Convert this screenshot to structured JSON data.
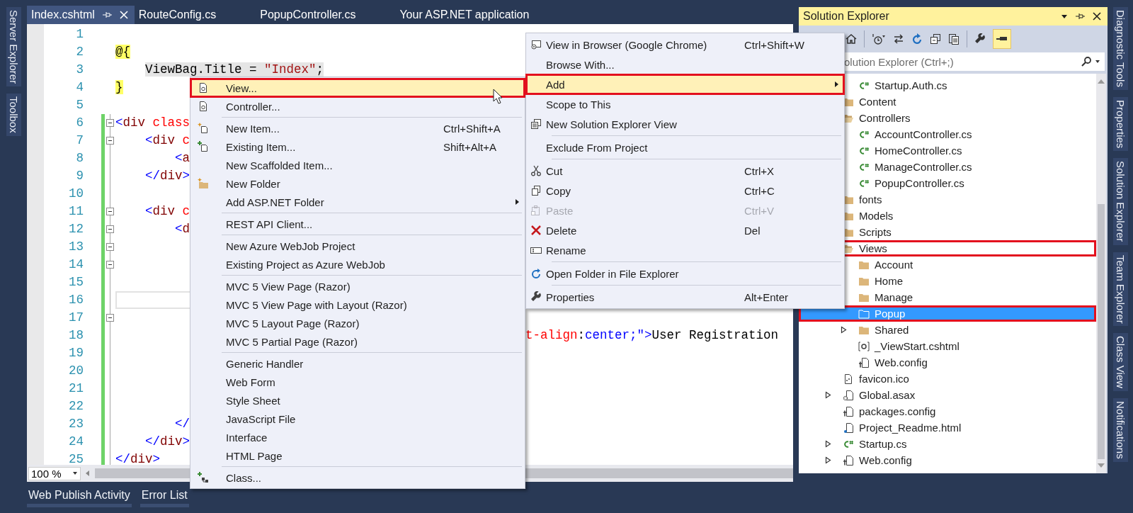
{
  "left_strip": {
    "tabs": [
      "Server Explorer",
      "Toolbox"
    ]
  },
  "editor": {
    "tabs": [
      {
        "label": "Index.cshtml",
        "selected": true
      },
      {
        "label": "RouteConfig.cs",
        "selected": false
      },
      {
        "label": "PopupController.cs",
        "selected": false
      },
      {
        "label": "Your ASP.NET application",
        "selected": false
      }
    ],
    "lines": [
      {
        "number": "1",
        "changed": false,
        "fold": false,
        "current": false
      },
      {
        "number": "2",
        "changed": false,
        "fold": false,
        "current": false,
        "tokens": [
          {
            "kind": "razor",
            "text": "@{"
          }
        ]
      },
      {
        "number": "3",
        "changed": false,
        "fold": false,
        "current": false,
        "tokens": [
          {
            "kind": "selected-text",
            "text": "    ViewBag.Title = "
          },
          {
            "kind": "selected-string",
            "text": "\"Index\""
          },
          {
            "kind": "selected-text",
            "text": ";"
          }
        ]
      },
      {
        "number": "4",
        "changed": false,
        "fold": false,
        "current": false,
        "tokens": [
          {
            "kind": "razor",
            "text": "}"
          }
        ]
      },
      {
        "number": "5",
        "changed": false,
        "fold": false,
        "current": false
      },
      {
        "number": "6",
        "changed": true,
        "fold": true,
        "current": false,
        "tokens": [
          {
            "kind": "punct",
            "text": "<"
          },
          {
            "kind": "tag",
            "text": "div"
          },
          {
            "kind": "attr",
            "text": " class"
          }
        ]
      },
      {
        "number": "7",
        "changed": true,
        "fold": true,
        "current": false,
        "tokens": [
          {
            "kind": "punct",
            "text": "    <"
          },
          {
            "kind": "tag",
            "text": "div"
          },
          {
            "kind": "attr",
            "text": " c"
          }
        ]
      },
      {
        "number": "8",
        "changed": true,
        "fold": false,
        "current": false,
        "tokens": [
          {
            "kind": "punct",
            "text": "        <"
          },
          {
            "kind": "tag",
            "text": "a"
          }
        ]
      },
      {
        "number": "9",
        "changed": true,
        "fold": false,
        "current": false,
        "tokens": [
          {
            "kind": "punct",
            "text": "    </"
          },
          {
            "kind": "tag",
            "text": "div"
          },
          {
            "kind": "punct",
            "text": ">"
          }
        ]
      },
      {
        "number": "10",
        "changed": true,
        "fold": false,
        "current": false
      },
      {
        "number": "11",
        "changed": true,
        "fold": true,
        "current": false,
        "tokens": [
          {
            "kind": "punct",
            "text": "    <"
          },
          {
            "kind": "tag",
            "text": "div"
          },
          {
            "kind": "attr",
            "text": " c"
          }
        ]
      },
      {
        "number": "12",
        "changed": true,
        "fold": true,
        "current": false,
        "tokens": [
          {
            "kind": "punct",
            "text": "        <"
          },
          {
            "kind": "tag",
            "text": "d"
          }
        ]
      },
      {
        "number": "13",
        "changed": true,
        "fold": true,
        "current": false
      },
      {
        "number": "14",
        "changed": true,
        "fold": true,
        "current": false
      },
      {
        "number": "15",
        "changed": true,
        "fold": false,
        "current": false
      },
      {
        "number": "16",
        "changed": true,
        "fold": false,
        "current": true
      },
      {
        "number": "17",
        "changed": true,
        "fold": true,
        "current": false
      },
      {
        "number": "18",
        "changed": true,
        "fold": false,
        "current": false,
        "tail": [
          {
            "kind": "attr",
            "text": "t-align"
          },
          {
            "kind": "text",
            "text": ":"
          },
          {
            "kind": "value",
            "text": "center;"
          },
          {
            "kind": "punct",
            "text": "\">"
          },
          {
            "kind": "text",
            "text": "User Registration"
          }
        ]
      },
      {
        "number": "19",
        "changed": true,
        "fold": false,
        "current": false
      },
      {
        "number": "20",
        "changed": true,
        "fold": false,
        "current": false
      },
      {
        "number": "21",
        "changed": true,
        "fold": false,
        "current": false
      },
      {
        "number": "22",
        "changed": true,
        "fold": false,
        "current": false
      },
      {
        "number": "23",
        "changed": true,
        "fold": false,
        "current": false,
        "tokens": [
          {
            "kind": "punct",
            "text": "        </"
          }
        ]
      },
      {
        "number": "24",
        "changed": true,
        "fold": false,
        "current": false,
        "tokens": [
          {
            "kind": "punct",
            "text": "    </"
          },
          {
            "kind": "tag",
            "text": "div"
          },
          {
            "kind": "punct",
            "text": ">"
          }
        ]
      },
      {
        "number": "25",
        "changed": true,
        "fold": false,
        "current": false,
        "tokens": [
          {
            "kind": "punct",
            "text": "</"
          },
          {
            "kind": "tag",
            "text": "div"
          },
          {
            "kind": "punct",
            "text": ">"
          }
        ]
      }
    ],
    "zoom": "100 %"
  },
  "bottom_tabs": [
    "Web Publish Activity",
    "Error List"
  ],
  "add_submenu": {
    "items": [
      {
        "kind": "item",
        "label": "View...",
        "selected": true,
        "outlined": true
      },
      {
        "kind": "item",
        "label": "Controller...",
        "selected": false,
        "outlined": false
      },
      {
        "kind": "separator"
      },
      {
        "kind": "item",
        "label": "New Item...",
        "shortcut": "Ctrl+Shift+A",
        "selected": false,
        "outlined": false
      },
      {
        "kind": "item",
        "label": "Existing Item...",
        "shortcut": "Shift+Alt+A",
        "selected": false,
        "outlined": false
      },
      {
        "kind": "item",
        "label": "New Scaffolded Item...",
        "selected": false,
        "outlined": false
      },
      {
        "kind": "item",
        "label": "New Folder",
        "selected": false,
        "outlined": false
      },
      {
        "kind": "submenu",
        "label": "Add ASP.NET Folder",
        "selected": false,
        "outlined": false
      },
      {
        "kind": "separator"
      },
      {
        "kind": "item",
        "label": "REST API Client...",
        "selected": false,
        "outlined": false
      },
      {
        "kind": "separator"
      },
      {
        "kind": "item",
        "label": "New Azure WebJob Project",
        "selected": false,
        "outlined": false
      },
      {
        "kind": "item",
        "label": "Existing Project as Azure WebJob",
        "selected": false,
        "outlined": false
      },
      {
        "kind": "separator"
      },
      {
        "kind": "item",
        "label": "MVC 5 View Page (Razor)",
        "selected": false,
        "outlined": false
      },
      {
        "kind": "item",
        "label": "MVC 5 View Page with Layout (Razor)",
        "selected": false,
        "outlined": false
      },
      {
        "kind": "item",
        "label": "MVC 5 Layout Page (Razor)",
        "selected": false,
        "outlined": false
      },
      {
        "kind": "item",
        "label": "MVC 5 Partial Page (Razor)",
        "selected": false,
        "outlined": false
      },
      {
        "kind": "separator"
      },
      {
        "kind": "item",
        "label": "Generic Handler",
        "selected": false,
        "outlined": false
      },
      {
        "kind": "item",
        "label": "Web Form",
        "selected": false,
        "outlined": false
      },
      {
        "kind": "item",
        "label": "Style Sheet",
        "selected": false,
        "outlined": false
      },
      {
        "kind": "item",
        "label": "JavaScript File",
        "selected": false,
        "outlined": false
      },
      {
        "kind": "item",
        "label": "Interface",
        "selected": false,
        "outlined": false
      },
      {
        "kind": "item",
        "label": "HTML Page",
        "selected": false,
        "outlined": false
      },
      {
        "kind": "separator"
      },
      {
        "kind": "item",
        "label": "Class...",
        "selected": false,
        "outlined": false
      }
    ]
  },
  "context_menu": {
    "items": [
      {
        "kind": "item",
        "label": "View in Browser (Google Chrome)",
        "shortcut": "Ctrl+Shift+W",
        "selected": false,
        "outlined": false,
        "disabled": false
      },
      {
        "kind": "item",
        "label": "Browse With...",
        "selected": false,
        "outlined": false,
        "disabled": false
      },
      {
        "kind": "submenu",
        "label": "Add",
        "selected": true,
        "outlined": true,
        "disabled": false
      },
      {
        "kind": "item",
        "label": "Scope to This",
        "selected": false,
        "outlined": false,
        "disabled": false
      },
      {
        "kind": "item",
        "label": "New Solution Explorer View",
        "selected": false,
        "outlined": false,
        "disabled": false
      },
      {
        "kind": "separator"
      },
      {
        "kind": "item",
        "label": "Exclude From Project",
        "selected": false,
        "outlined": false,
        "disabled": false
      },
      {
        "kind": "separator"
      },
      {
        "kind": "item",
        "label": "Cut",
        "shortcut": "Ctrl+X",
        "selected": false,
        "outlined": false,
        "disabled": false
      },
      {
        "kind": "item",
        "label": "Copy",
        "shortcut": "Ctrl+C",
        "selected": false,
        "outlined": false,
        "disabled": false
      },
      {
        "kind": "item",
        "label": "Paste",
        "shortcut": "Ctrl+V",
        "selected": false,
        "outlined": false,
        "disabled": true
      },
      {
        "kind": "item",
        "label": "Delete",
        "shortcut": "Del",
        "selected": false,
        "outlined": false,
        "disabled": false
      },
      {
        "kind": "item",
        "label": "Rename",
        "selected": false,
        "outlined": false,
        "disabled": false
      },
      {
        "kind": "separator"
      },
      {
        "kind": "item",
        "label": "Open Folder in File Explorer",
        "selected": false,
        "outlined": false,
        "disabled": false
      },
      {
        "kind": "separator"
      },
      {
        "kind": "item",
        "label": "Properties",
        "shortcut": "Alt+Enter",
        "selected": false,
        "outlined": false,
        "disabled": false
      }
    ]
  },
  "solution_explorer": {
    "title": "Solution Explorer",
    "search": {
      "placeholder": "olution Explorer (Ctrl+;)"
    },
    "tree": [
      {
        "children": [
          {
            "label": "Startup.Auth.cs",
            "kind": "csharp",
            "selected": false,
            "outlined": false
          }
        ]
      },
      {
        "label": "Content",
        "kind": "folder",
        "selected": false,
        "outlined": false
      },
      {
        "label": "Controllers",
        "kind": "open-folder",
        "selected": false,
        "outlined": false,
        "children": [
          {
            "label": "AccountController.cs",
            "kind": "csharp",
            "selected": false,
            "outlined": false
          },
          {
            "label": "HomeController.cs",
            "kind": "csharp",
            "selected": false,
            "outlined": false
          },
          {
            "label": "ManageController.cs",
            "kind": "csharp",
            "selected": false,
            "outlined": false
          },
          {
            "label": "PopupController.cs",
            "kind": "csharp",
            "selected": false,
            "outlined": false
          }
        ]
      },
      {
        "label": "fonts",
        "kind": "folder",
        "selected": false,
        "outlined": false
      },
      {
        "label": "Models",
        "kind": "folder",
        "selected": false,
        "outlined": false
      },
      {
        "label": "Scripts",
        "kind": "folder",
        "selected": false,
        "outlined": false
      },
      {
        "label": "Views",
        "kind": "open-folder",
        "selected": false,
        "outlined": true,
        "children": [
          {
            "label": "Account",
            "kind": "folder",
            "selected": false,
            "outlined": false
          },
          {
            "label": "Home",
            "kind": "folder",
            "selected": false,
            "outlined": false
          },
          {
            "label": "Manage",
            "kind": "folder",
            "selected": false,
            "outlined": false
          },
          {
            "label": "Popup",
            "kind": "folder",
            "selected": true,
            "outlined": true
          },
          {
            "label": "Shared",
            "kind": "folder",
            "selected": false,
            "outlined": false,
            "expanded": false
          },
          {
            "label": "_ViewStart.cshtml",
            "kind": "razor",
            "selected": false,
            "outlined": false
          },
          {
            "label": "Web.config",
            "kind": "config",
            "selected": false,
            "outlined": false
          }
        ]
      },
      {
        "label": "favicon.ico",
        "kind": "image",
        "selected": false,
        "outlined": false
      },
      {
        "label": "Global.asax",
        "kind": "asax",
        "selected": false,
        "outlined": false,
        "expanded": false
      },
      {
        "label": "packages.config",
        "kind": "config",
        "selected": false,
        "outlined": false
      },
      {
        "label": "Project_Readme.html",
        "kind": "html",
        "selected": false,
        "outlined": false
      },
      {
        "label": "Startup.cs",
        "kind": "csharp",
        "selected": false,
        "outlined": false,
        "expanded": false
      },
      {
        "label": "Web.config",
        "kind": "config",
        "selected": false,
        "outlined": false,
        "expanded": false
      }
    ]
  },
  "right_strip": {
    "tabs": [
      "Diagnostic Tools",
      "Properties",
      "Solution Explorer",
      "Team Explorer",
      "Class View",
      "Notifications"
    ]
  }
}
